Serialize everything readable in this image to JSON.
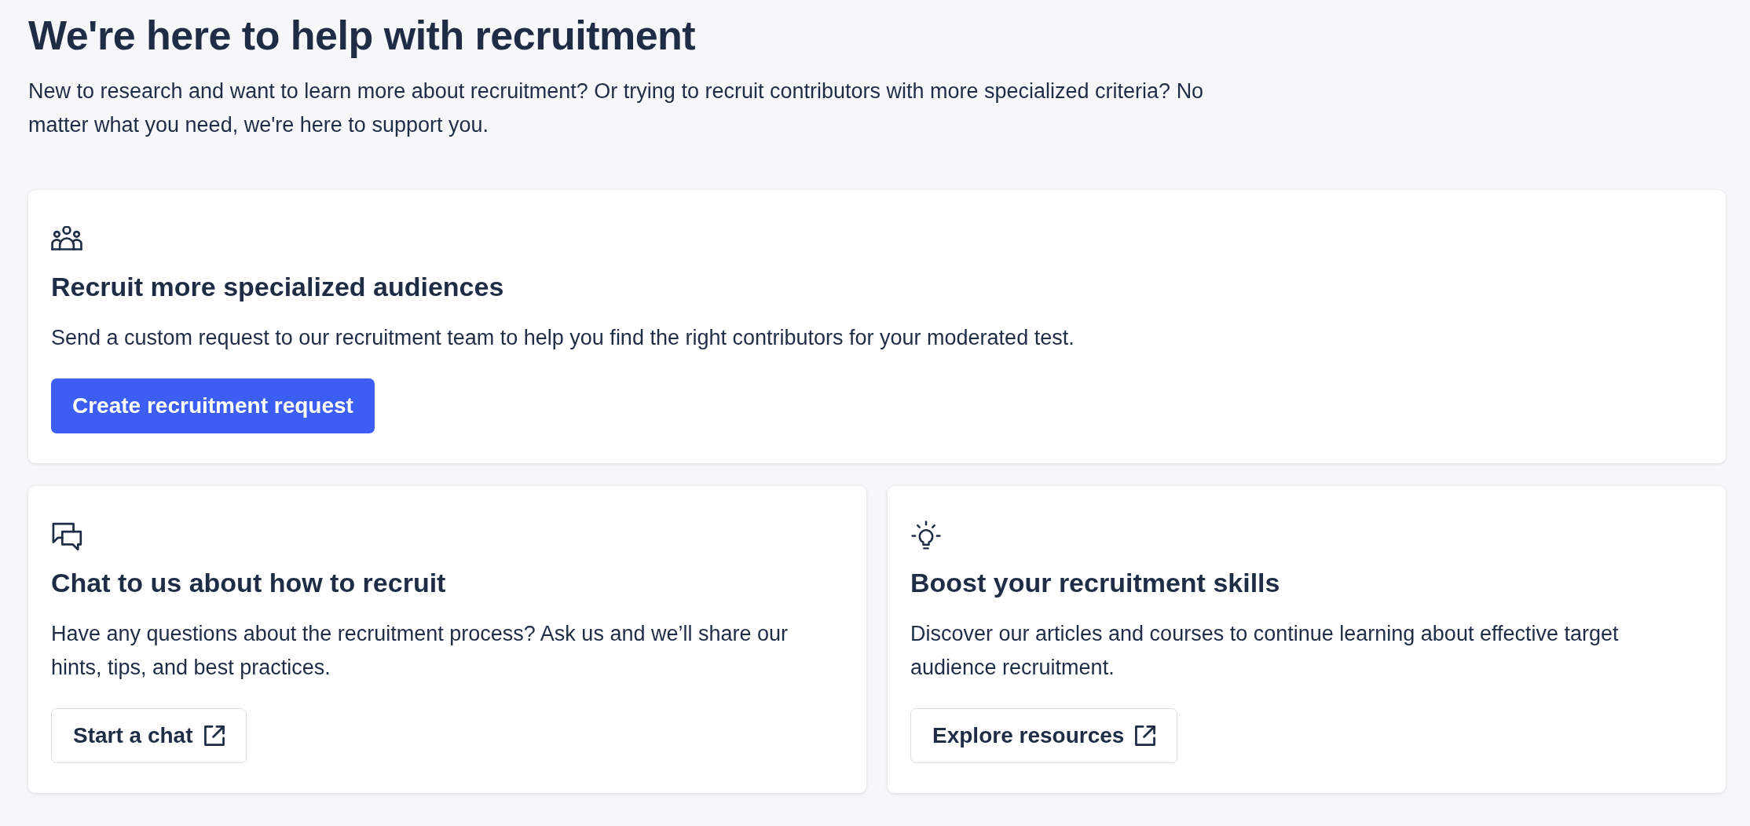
{
  "header": {
    "title": "We're here to help with recruitment",
    "intro": "New to research and want to learn more about recruitment? Or trying to recruit contributors with more specialized criteria? No matter what you need, we're here to support you."
  },
  "featured_card": {
    "title": "Recruit more specialized audiences",
    "description": "Send a custom request to our recruitment team to help you find the right contributors for your moderated test.",
    "button": {
      "label": "Create recruitment request",
      "kind": "primary"
    }
  },
  "cards": [
    {
      "title": "Chat to us about how to recruit",
      "description": "Have any questions about the recruitment process? Ask us and we’ll share our hints, tips, and best practices.",
      "button": {
        "label": "Start a chat",
        "kind": "external"
      }
    },
    {
      "title": "Boost your recruitment skills",
      "description": "Discover our articles and courses to continue learning about effective target audience recruitment.",
      "button": {
        "label": "Explore resources",
        "kind": "external"
      }
    }
  ]
}
